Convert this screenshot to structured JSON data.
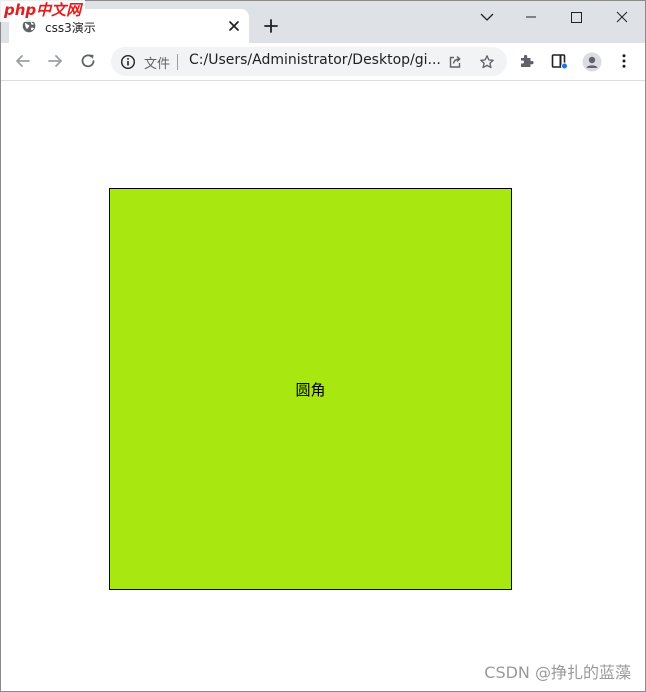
{
  "browser": {
    "tab": {
      "title": "css3演示",
      "favicon": "globe-icon"
    },
    "toolbar": {
      "security_label": "文件",
      "url": "C:/Users/Administrator/Desktop/gi..."
    }
  },
  "page": {
    "demo_box": {
      "text": "圆角",
      "background": "#a8e70f"
    }
  },
  "watermarks": {
    "top_left": "php中文网",
    "bottom_right": "CSDN @挣扎的蓝藻"
  },
  "colors": {
    "titlebar": "#dee1e6",
    "omnibox": "#f1f3f4"
  }
}
